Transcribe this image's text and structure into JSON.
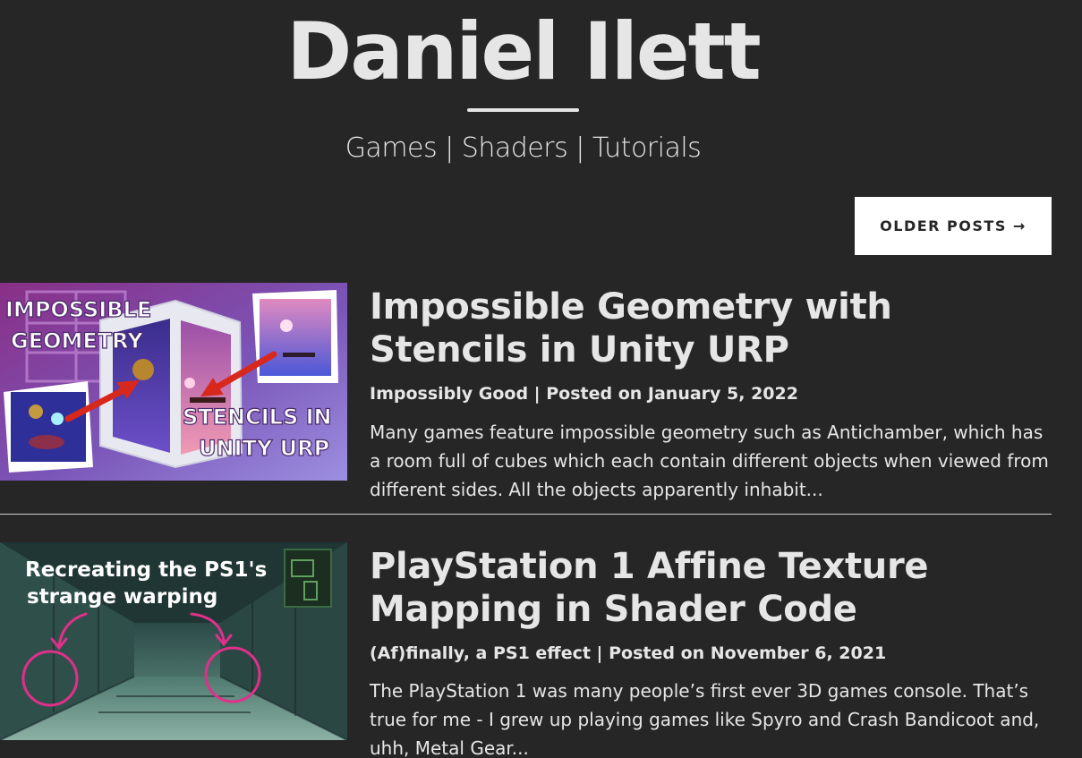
{
  "header": {
    "site_title": "Daniel Ilett",
    "tagline": "Games | Shaders | Tutorials"
  },
  "navigation": {
    "older_posts_label": "OLDER POSTS →"
  },
  "posts": [
    {
      "title": "Impossible Geometry with Stencils in Unity URP",
      "meta": "Impossibly Good | Posted on January 5, 2022",
      "excerpt": "Many games feature impossible geometry such as Antichamber, which has a room full of cubes which each contain different objects when viewed from different sides. All the objects apparently inhabit...",
      "thumbnail_text": [
        "IMPOSSIBLE",
        "GEOMETRY",
        "STENCILS IN",
        "UNITY URP"
      ]
    },
    {
      "title": "PlayStation 1 Affine Texture Mapping in Shader Code",
      "meta": "(Af)finally, a PS1 effect | Posted on November 6, 2021",
      "excerpt": "The PlayStation 1 was many people’s first ever 3D games console. That’s true for me - I grew up playing games like Spyro and Crash Bandicoot and, uhh, Metal Gear...",
      "thumbnail_text": [
        "Recreating the PS1's",
        "strange warping"
      ]
    }
  ],
  "colors": {
    "background": "#262626",
    "text": "#e6e6e6",
    "button_bg": "#ffffff",
    "button_text": "#262626",
    "accent_red": "#d8281c",
    "accent_pink": "#e0308a"
  }
}
